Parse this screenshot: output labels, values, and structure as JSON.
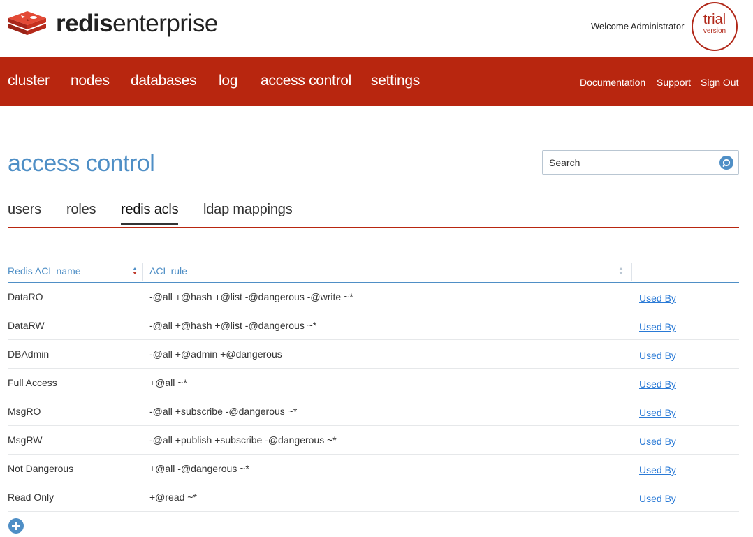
{
  "header": {
    "logo_bold": "redis",
    "logo_light": "enterprise",
    "welcome": "Welcome Administrator",
    "badge_line1": "trial",
    "badge_line2": "version"
  },
  "nav": {
    "items": [
      "cluster",
      "nodes",
      "databases",
      "log",
      "access control",
      "settings"
    ],
    "right": [
      "Documentation",
      "Support",
      "Sign Out"
    ]
  },
  "page": {
    "title": "access control",
    "search_placeholder": "Search"
  },
  "tabs": [
    "users",
    "roles",
    "redis acls",
    "ldap mappings"
  ],
  "active_tab": "redis acls",
  "table": {
    "columns": [
      "Redis ACL name",
      "ACL rule"
    ],
    "link_label": "Used By",
    "rows": [
      {
        "name": "DataRO",
        "rule": "-@all +@hash +@list -@dangerous -@write ~*"
      },
      {
        "name": "DataRW",
        "rule": "-@all +@hash +@list -@dangerous ~*"
      },
      {
        "name": "DBAdmin",
        "rule": "-@all +@admin +@dangerous"
      },
      {
        "name": "Full Access",
        "rule": "+@all ~*"
      },
      {
        "name": "MsgRO",
        "rule": "-@all +subscribe -@dangerous ~*"
      },
      {
        "name": "MsgRW",
        "rule": "-@all +publish +subscribe -@dangerous ~*"
      },
      {
        "name": "Not Dangerous",
        "rule": "+@all -@dangerous ~*"
      },
      {
        "name": "Read Only",
        "rule": "+@read ~*"
      }
    ]
  },
  "colors": {
    "brand_red": "#b8260f",
    "accent_blue": "#4f8fc6",
    "link_blue": "#2a7ad6"
  },
  "icons": [
    "redis-logo-icon",
    "search-icon",
    "sort-icon",
    "add-icon"
  ]
}
